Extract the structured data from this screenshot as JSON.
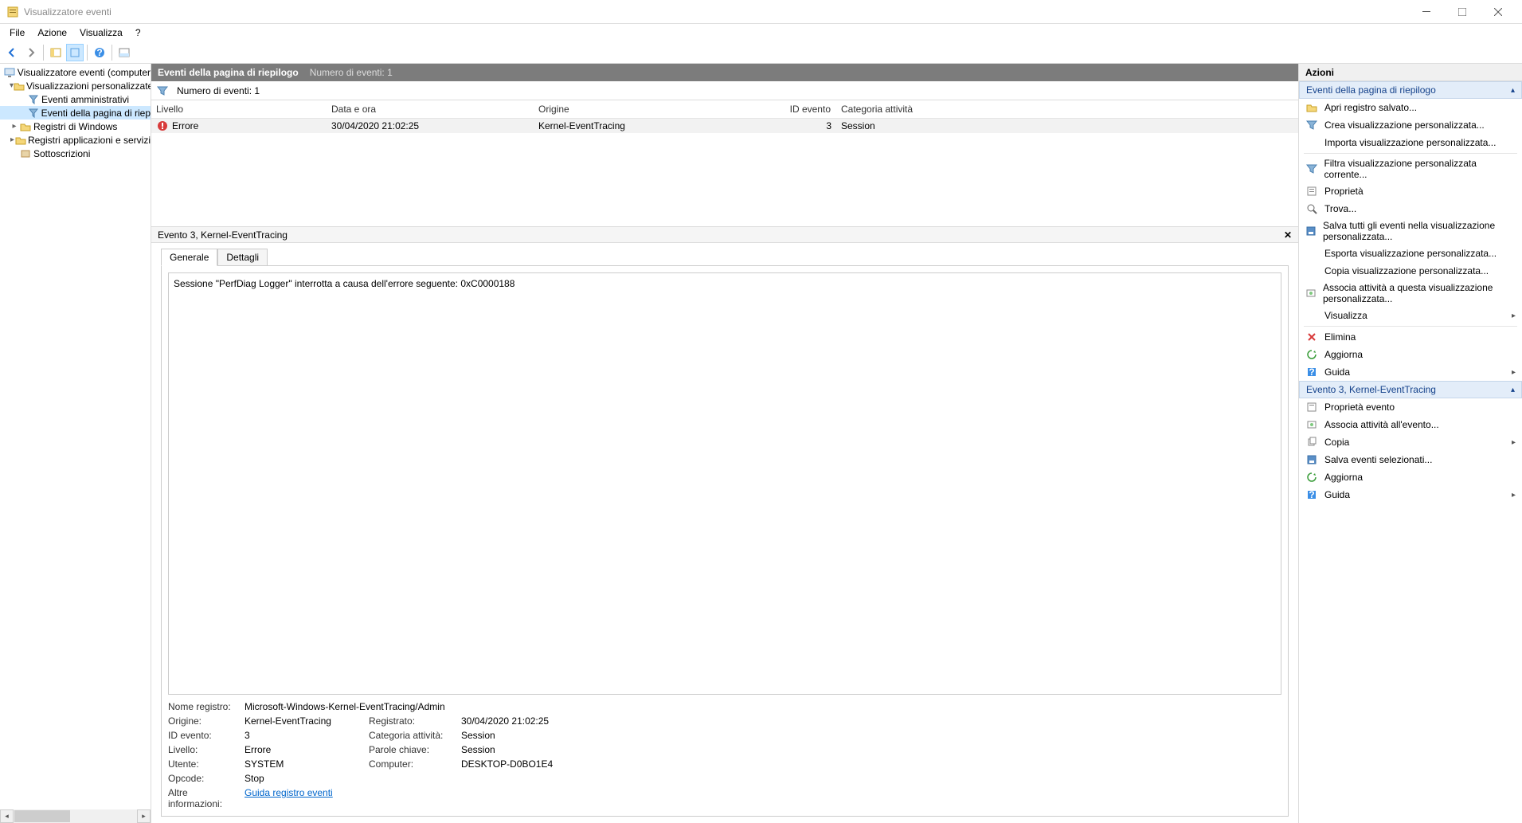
{
  "window": {
    "title": "Visualizzatore eventi"
  },
  "menu": {
    "file": "File",
    "action": "Azione",
    "view": "Visualizza",
    "help": "?"
  },
  "tree": {
    "root": "Visualizzatore eventi (computer",
    "custom_views": "Visualizzazioni personalizzate",
    "admin_events": "Eventi amministrativi",
    "summary_events": "Eventi della pagina di riep",
    "windows_logs": "Registri di Windows",
    "app_services": "Registri applicazioni e servizi",
    "subscriptions": "Sottoscrizioni"
  },
  "center": {
    "title": "Eventi della pagina di riepilogo",
    "subtitle": "Numero di eventi: 1",
    "filter_count": "Numero di eventi: 1",
    "columns": {
      "level": "Livello",
      "date": "Data e ora",
      "source": "Origine",
      "id": "ID evento",
      "category": "Categoria attività"
    },
    "row": {
      "level": "Errore",
      "date": "30/04/2020 21:02:25",
      "source": "Kernel-EventTracing",
      "id": "3",
      "category": "Session"
    }
  },
  "detail": {
    "title": "Evento 3, Kernel-EventTracing",
    "tabs": {
      "general": "Generale",
      "details": "Dettagli"
    },
    "message": "Sessione \"PerfDiag Logger\" interrotta a causa dell'errore seguente: 0xC0000188",
    "labels": {
      "log_name": "Nome registro:",
      "source": "Origine:",
      "event_id": "ID evento:",
      "level": "Livello:",
      "user": "Utente:",
      "opcode": "Opcode:",
      "more_info": "Altre informazioni:",
      "logged": "Registrato:",
      "category": "Categoria attività:",
      "keywords": "Parole chiave:",
      "computer": "Computer:"
    },
    "values": {
      "log_name": "Microsoft-Windows-Kernel-EventTracing/Admin",
      "source": "Kernel-EventTracing",
      "logged": "30/04/2020 21:02:25",
      "event_id": "3",
      "category": "Session",
      "level": "Errore",
      "keywords": "Session",
      "user": "SYSTEM",
      "computer": "DESKTOP-D0BO1E4",
      "opcode": "Stop",
      "help_link": "Guida registro eventi"
    }
  },
  "actions": {
    "title": "Azioni",
    "section1": "Eventi della pagina di riepilogo",
    "items1": {
      "open_saved": "Apri registro salvato...",
      "create_view": "Crea visualizzazione personalizzata...",
      "import_view": "Importa visualizzazione personalizzata...",
      "filter_view": "Filtra visualizzazione personalizzata corrente...",
      "properties": "Proprietà",
      "find": "Trova...",
      "save_all": "Salva tutti gli eventi nella visualizzazione personalizzata...",
      "export_view": "Esporta visualizzazione personalizzata...",
      "copy_view": "Copia visualizzazione personalizzata...",
      "attach_task": "Associa attività a questa visualizzazione personalizzata...",
      "view": "Visualizza",
      "delete": "Elimina",
      "refresh": "Aggiorna",
      "help": "Guida"
    },
    "section2": "Evento 3, Kernel-EventTracing",
    "items2": {
      "event_props": "Proprietà evento",
      "attach_event": "Associa attività all'evento...",
      "copy": "Copia",
      "save_selected": "Salva eventi selezionati...",
      "refresh": "Aggiorna",
      "help": "Guida"
    }
  }
}
